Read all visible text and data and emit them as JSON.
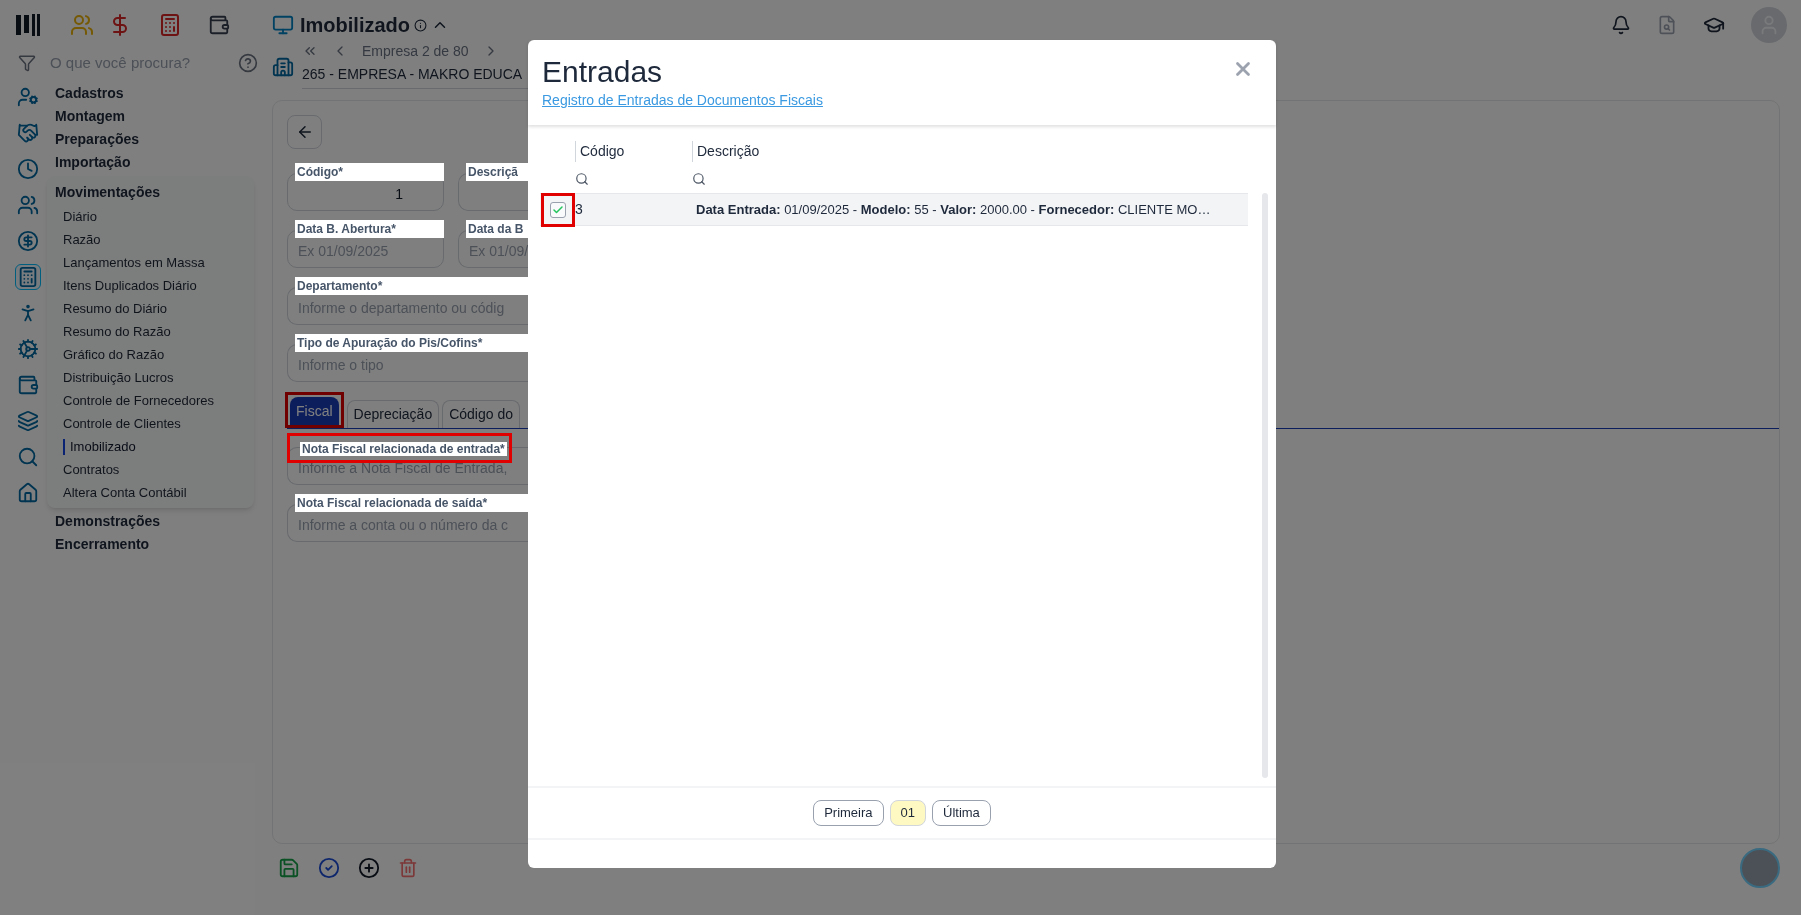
{
  "header": {
    "title": "Imobilizado"
  },
  "sidebar": {
    "search_placeholder": "O que você procura?",
    "menu": [
      {
        "label": "Cadastros",
        "expanded": false
      },
      {
        "label": "Montagem",
        "expanded": false
      },
      {
        "label": "Preparações",
        "expanded": false
      },
      {
        "label": "Importação",
        "expanded": false
      },
      {
        "label": "Movimentações",
        "expanded": true,
        "children": [
          {
            "label": "Diário",
            "selected": false
          },
          {
            "label": "Razão",
            "selected": false
          },
          {
            "label": "Lançamentos em Massa",
            "selected": false
          },
          {
            "label": "Itens Duplicados Diário",
            "selected": false
          },
          {
            "label": "Resumo do Diário",
            "selected": false
          },
          {
            "label": "Resumo do Razão",
            "selected": false
          },
          {
            "label": "Gráfico do Razão",
            "selected": false
          },
          {
            "label": "Distribuição Lucros",
            "selected": false
          },
          {
            "label": "Controle de Fornecedores",
            "selected": false
          },
          {
            "label": "Controle de Clientes",
            "selected": false
          },
          {
            "label": "Imobilizado",
            "selected": true
          },
          {
            "label": "Contratos",
            "selected": false
          },
          {
            "label": "Altera Conta Contábil",
            "selected": false
          }
        ]
      },
      {
        "label": "Demonstrações",
        "expanded": false
      },
      {
        "label": "Encerramento",
        "expanded": false
      }
    ]
  },
  "company_nav": {
    "position": "Empresa 2 de 80",
    "company": "265 - EMPRESA - MAKRO EDUCA"
  },
  "form": {
    "rows": [
      [
        {
          "label": "Código*",
          "value": "1",
          "highlighted": false
        },
        {
          "label": "Descriçã",
          "highlighted": false
        }
      ],
      [
        {
          "label": "Data B. Abertura*",
          "placeholder": "Ex 01/09/2025",
          "highlighted": false
        },
        {
          "label": "Data da B",
          "placeholder": "Ex 01/09/",
          "highlighted": false
        }
      ],
      [
        {
          "label": "Departamento*",
          "placeholder": "Informe o departamento ou códig",
          "highlighted": false
        }
      ],
      [
        {
          "label": "Tipo de Apuração do Pis/Cofins*",
          "placeholder": "Informe o tipo",
          "highlighted": false
        }
      ]
    ],
    "tabs": [
      {
        "label": "Fiscal",
        "selected": true,
        "highlighted": true
      },
      {
        "label": "Depreciação",
        "selected": false,
        "highlighted": false
      },
      {
        "label": "Código do",
        "selected": false,
        "highlighted": false
      }
    ],
    "tab_fields": [
      {
        "label": "Nota Fiscal relacionada de entrada*",
        "placeholder": "Informe a Nota Fiscal de Entrada,",
        "highlighted": true
      },
      {
        "label": "Nota Fiscal relacionada de saída*",
        "placeholder": "Informe a conta ou o número da c",
        "highlighted": false
      }
    ]
  },
  "modal": {
    "title": "Entradas",
    "link": "Registro de Entradas de Documentos Fiscais",
    "columns": [
      "Código",
      "Descrição"
    ],
    "rows": [
      {
        "checked": true,
        "highlighted": true,
        "code": "3",
        "description": "**Data Entrada:** 01/09/2025 - **Modelo:** 55 - **Valor:** 2000.00 - **Fornecedor:** CLIENTE MO…"
      }
    ],
    "pager": [
      {
        "label": "Primeira",
        "selected": false
      },
      {
        "label": "01",
        "selected": true
      },
      {
        "label": "Última",
        "selected": false
      }
    ]
  }
}
